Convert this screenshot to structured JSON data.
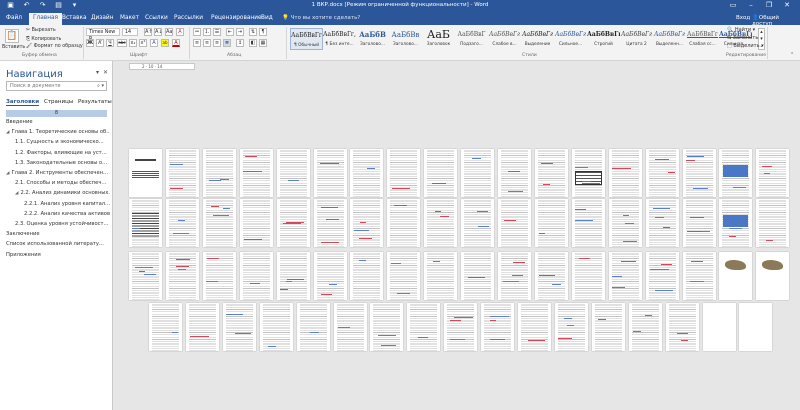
{
  "title_bar": {
    "title": "1 ВКР.docx [Режим ограниченной функциональности] - Word",
    "qat": [
      "save-icon",
      "undo-icon",
      "redo-icon",
      "print-preview-icon",
      "customize-icon"
    ],
    "controls": [
      "ribbon-display-icon",
      "minimize-icon",
      "restore-icon",
      "close-icon"
    ]
  },
  "tabs": {
    "items": [
      "Файл",
      "Главная",
      "Вставка",
      "Дизайн",
      "Макет",
      "Ссылки",
      "Рассылки",
      "Рецензирование",
      "Вид"
    ],
    "active": "Главная",
    "tell_me": "Что вы хотите сделать?",
    "sign_in": "Вход",
    "share": "Общий доступ"
  },
  "ribbon": {
    "clipboard": {
      "paste": "Вставить",
      "cut": "Вырезать",
      "copy": "Копировать",
      "format_painter": "Формат по образцу",
      "label": "Буфер обмена"
    },
    "font": {
      "name": "Times New R",
      "size": "14",
      "label": "Шрифт",
      "bold": "Ж",
      "italic": "К",
      "underline": "Ч",
      "strike": "abc",
      "sub": "x₂",
      "sup": "x²",
      "grow": "A↑",
      "shrink": "A↓",
      "case": "Aa",
      "clear": "A",
      "highlight": "ab",
      "color": "A"
    },
    "paragraph": {
      "label": "Абзац",
      "pilcrow": "¶"
    },
    "styles": {
      "label": "Стили",
      "items": [
        {
          "preview": "АаБбВвГг,",
          "name": "¶ Обычный"
        },
        {
          "preview": "АаБбВвГг,",
          "name": "¶ Без инте..."
        },
        {
          "preview": "АаБбВ",
          "name": "Заголово..."
        },
        {
          "preview": "АаБбВв",
          "name": "Заголово..."
        },
        {
          "preview": "АаБ",
          "name": "Заголовок"
        },
        {
          "preview": "АаБбВвГ",
          "name": "Подзаго..."
        },
        {
          "preview": "АаБбВвГг",
          "name": "Слабое в..."
        },
        {
          "preview": "АаБбВвГг",
          "name": "Выделение"
        },
        {
          "preview": "АаБбВвГг",
          "name": "Сильное..."
        },
        {
          "preview": "АаБбВвГг",
          "name": "Строгий"
        },
        {
          "preview": "АаБбВвГг",
          "name": "Цитата 2"
        },
        {
          "preview": "АаБбВвГг",
          "name": "Выделенн..."
        },
        {
          "preview": "АаБбВвГг",
          "name": "Слабая сс..."
        },
        {
          "preview": "АаБбВвГг",
          "name": "Сильная..."
        }
      ]
    },
    "editing": {
      "find": "Найти",
      "replace": "Заменить",
      "select": "Выделить",
      "label": "Редактирование"
    }
  },
  "ruler": {
    "text": "2 · 10 · 14"
  },
  "navigation": {
    "title": "Навигация",
    "search_placeholder": "Поиск в документе",
    "tabs": [
      "Заголовки",
      "Страницы",
      "Результаты"
    ],
    "active_tab": "Заголовки",
    "strip": "8",
    "items": [
      {
        "label": "Введение",
        "level": 0,
        "arrow": ""
      },
      {
        "label": "Глава 1. Теоретические основы об...",
        "level": 0,
        "arrow": "◢"
      },
      {
        "label": "1.1. Сущность и экономическо...",
        "level": 1,
        "arrow": ""
      },
      {
        "label": "1.2. Факторы, влияющие на уст...",
        "level": 1,
        "arrow": ""
      },
      {
        "label": "1.3. Законодательные основы о...",
        "level": 1,
        "arrow": ""
      },
      {
        "label": "Глава 2. Инструменты обеспечен...",
        "level": 0,
        "arrow": "◢"
      },
      {
        "label": "2.1. Способы и методы обеспеч...",
        "level": 1,
        "arrow": ""
      },
      {
        "label": "2.2. Анализ динамики основных...",
        "level": 1,
        "arrow": "◢"
      },
      {
        "label": "2.2.1. Анализ уровня капитал...",
        "level": 2,
        "arrow": ""
      },
      {
        "label": "2.2.2. Анализ качества активов",
        "level": 2,
        "arrow": ""
      },
      {
        "label": "2.3. Оценка уровня устойчивост...",
        "level": 1,
        "arrow": ""
      },
      {
        "label": "Заключение",
        "level": 0,
        "arrow": ""
      },
      {
        "label": "Список использованной литерату...",
        "level": 0,
        "arrow": ""
      },
      {
        "label": "Приложения",
        "level": 0,
        "arrow": ""
      }
    ]
  },
  "document": {
    "rows": [
      {
        "count": 18,
        "pages": [
          "title",
          "text",
          "text",
          "text",
          "text",
          "text",
          "text",
          "text",
          "text",
          "text",
          "text",
          "text",
          "table",
          "text",
          "text",
          "text",
          "chart",
          "text"
        ]
      },
      {
        "count": 18,
        "pages": [
          "tablefull",
          "text",
          "text",
          "text",
          "text",
          "text",
          "text",
          "text",
          "text",
          "text",
          "text",
          "text",
          "text",
          "text",
          "text",
          "text",
          "chart",
          "text"
        ]
      },
      {
        "count": 18,
        "pages": [
          "text",
          "text",
          "text",
          "text",
          "text",
          "text",
          "text",
          "text",
          "text",
          "text",
          "text",
          "text",
          "text",
          "text",
          "text",
          "text",
          "image",
          "image"
        ]
      },
      {
        "count": 17,
        "pages": [
          "text",
          "text",
          "text",
          "text",
          "text",
          "text",
          "text",
          "text",
          "text",
          "text",
          "text",
          "text",
          "text",
          "text",
          "text",
          "blank",
          "blank"
        ]
      }
    ],
    "accent_red": "#d04a5a",
    "accent_blue": "#5a7fd0"
  },
  "colors": {
    "brand": "#2b579a",
    "ribbon_bg": "#f3f3f3",
    "canvas": "#e6e6e6"
  }
}
